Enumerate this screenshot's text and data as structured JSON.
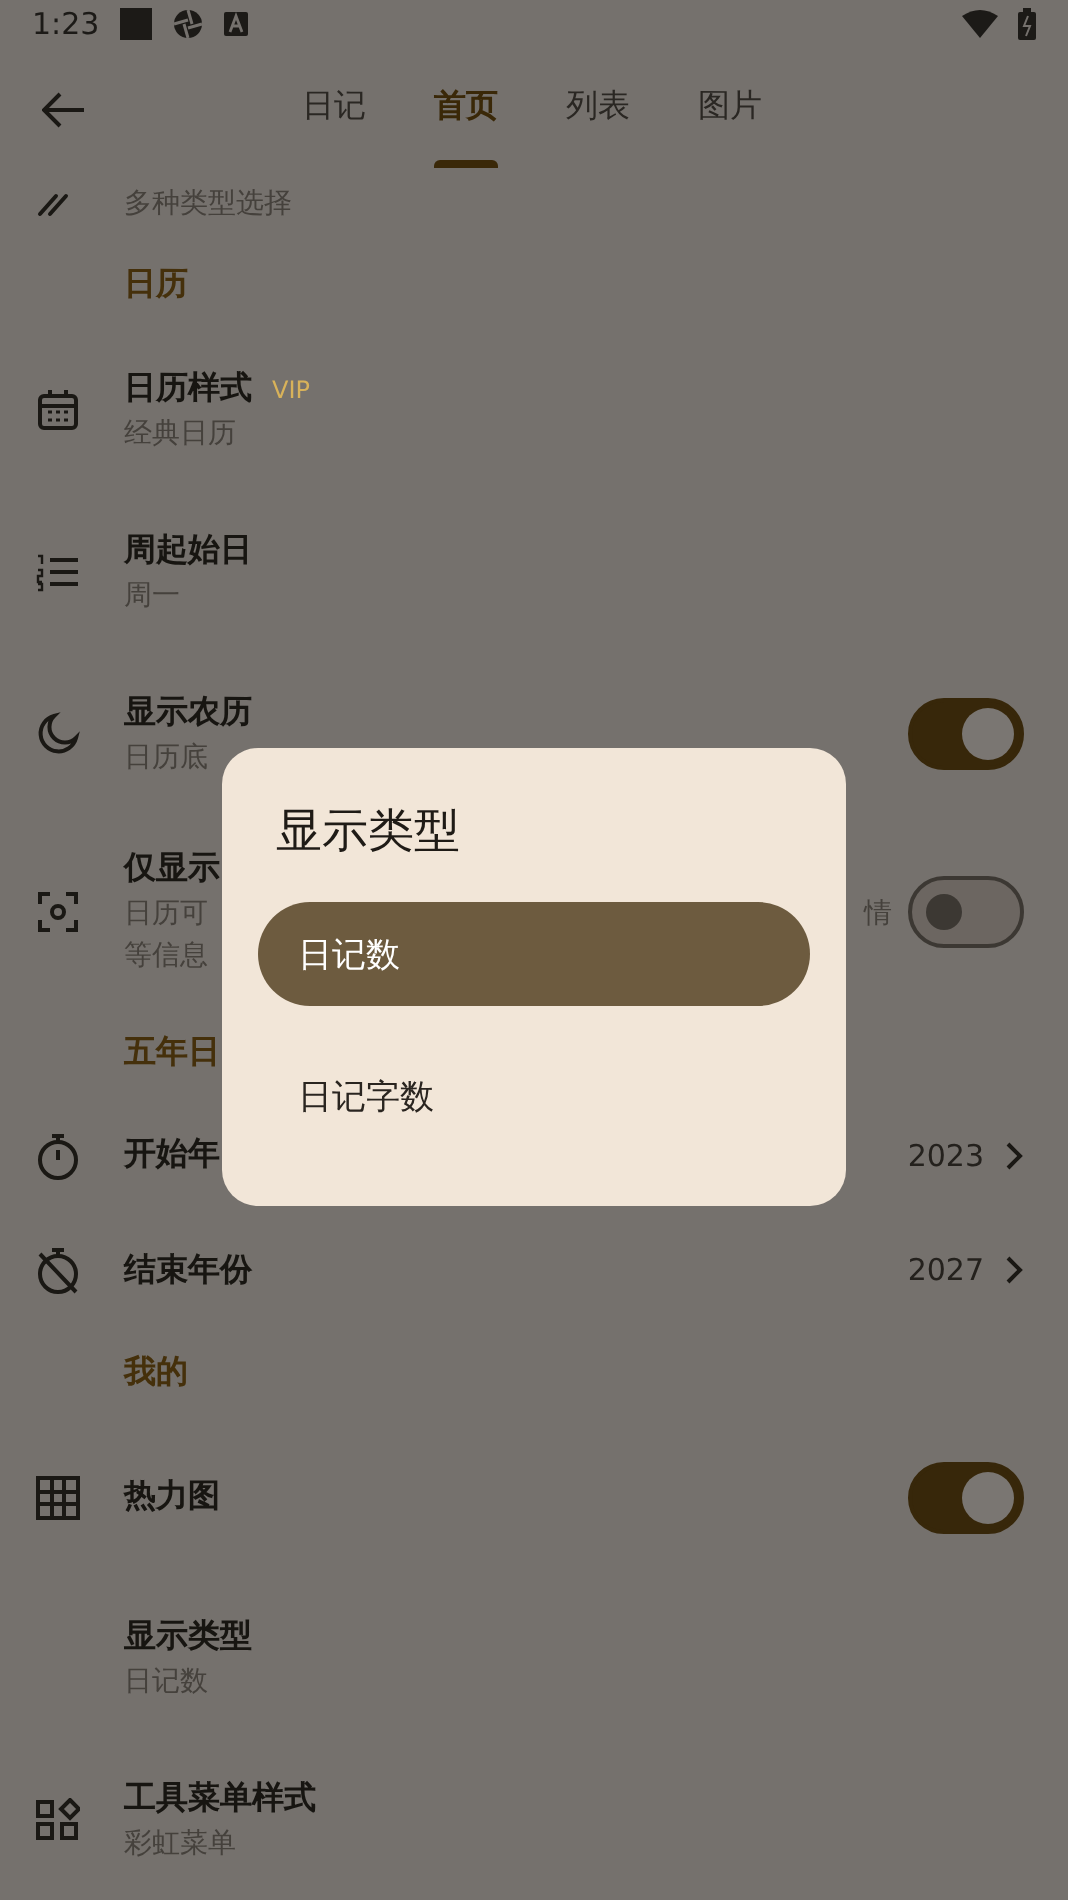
{
  "status_bar": {
    "time": "1:23"
  },
  "tabs": [
    {
      "label": "日记",
      "selected": false
    },
    {
      "label": "首页",
      "selected": true
    },
    {
      "label": "列表",
      "selected": false
    },
    {
      "label": "图片",
      "selected": false
    }
  ],
  "rows": [
    {
      "kind": "partial",
      "subtitle": "多种类型选择"
    },
    {
      "kind": "section",
      "title": "日历"
    },
    {
      "kind": "item",
      "title": "日历样式",
      "badge": "VIP",
      "subtitle": "经典日历"
    },
    {
      "kind": "item",
      "title": "周起始日",
      "subtitle": "周一"
    },
    {
      "kind": "toggle",
      "title": "显示农历",
      "subtitle": "日历底",
      "on": true
    },
    {
      "kind": "toggle",
      "title": "仅显示",
      "subtitle": "日历可",
      "subtitle_end": "情",
      "subtitle_2": "等信息",
      "on": false
    },
    {
      "kind": "section",
      "title": "五年日"
    },
    {
      "kind": "value",
      "title": "开始年",
      "value": "2023"
    },
    {
      "kind": "value",
      "title": "结束年份",
      "value": "2027"
    },
    {
      "kind": "section",
      "title": "我的"
    },
    {
      "kind": "toggle",
      "title": "热力图",
      "on": true
    },
    {
      "kind": "item",
      "title": "显示类型",
      "subtitle": "日记数"
    },
    {
      "kind": "item",
      "title": "工具菜单样式",
      "subtitle": "彩虹菜单"
    }
  ],
  "dialog": {
    "title": "显示类型",
    "options": [
      {
        "label": "日记数",
        "selected": true
      },
      {
        "label": "日记字数",
        "selected": false
      }
    ]
  }
}
